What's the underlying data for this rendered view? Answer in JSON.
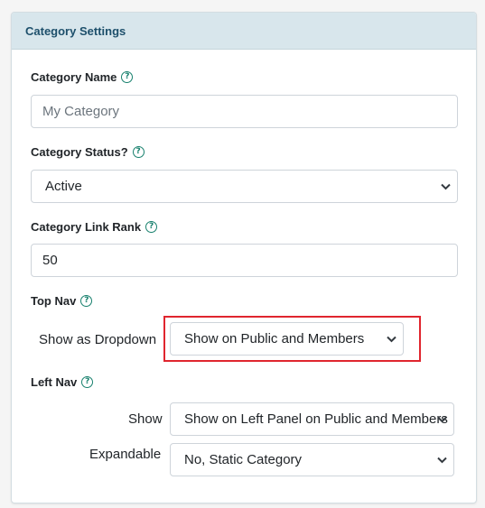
{
  "panel": {
    "title": "Category Settings"
  },
  "category_name": {
    "label": "Category Name",
    "help_icon": "question-circle-icon",
    "placeholder": "My Category"
  },
  "category_status": {
    "label": "Category Status?",
    "help_icon": "question-circle-icon",
    "selected": "Active"
  },
  "category_link_rank": {
    "label": "Category Link Rank",
    "help_icon": "question-circle-icon",
    "value": "50"
  },
  "top_nav": {
    "label": "Top Nav",
    "help_icon": "question-circle-icon",
    "dropdown_label": "Show as Dropdown",
    "dropdown_selected": "Show on Public and Members"
  },
  "left_nav": {
    "label": "Left Nav",
    "help_icon": "question-circle-icon",
    "show_label": "Show",
    "show_selected": "Show on Left Panel on Public and Members",
    "expandable_label": "Expandable",
    "expandable_selected": "No, Static Category"
  },
  "colors": {
    "header_bg": "#d8e6ec",
    "title_text": "#1d4f6b",
    "help_icon": "#17806d",
    "highlight": "#e0252e"
  }
}
